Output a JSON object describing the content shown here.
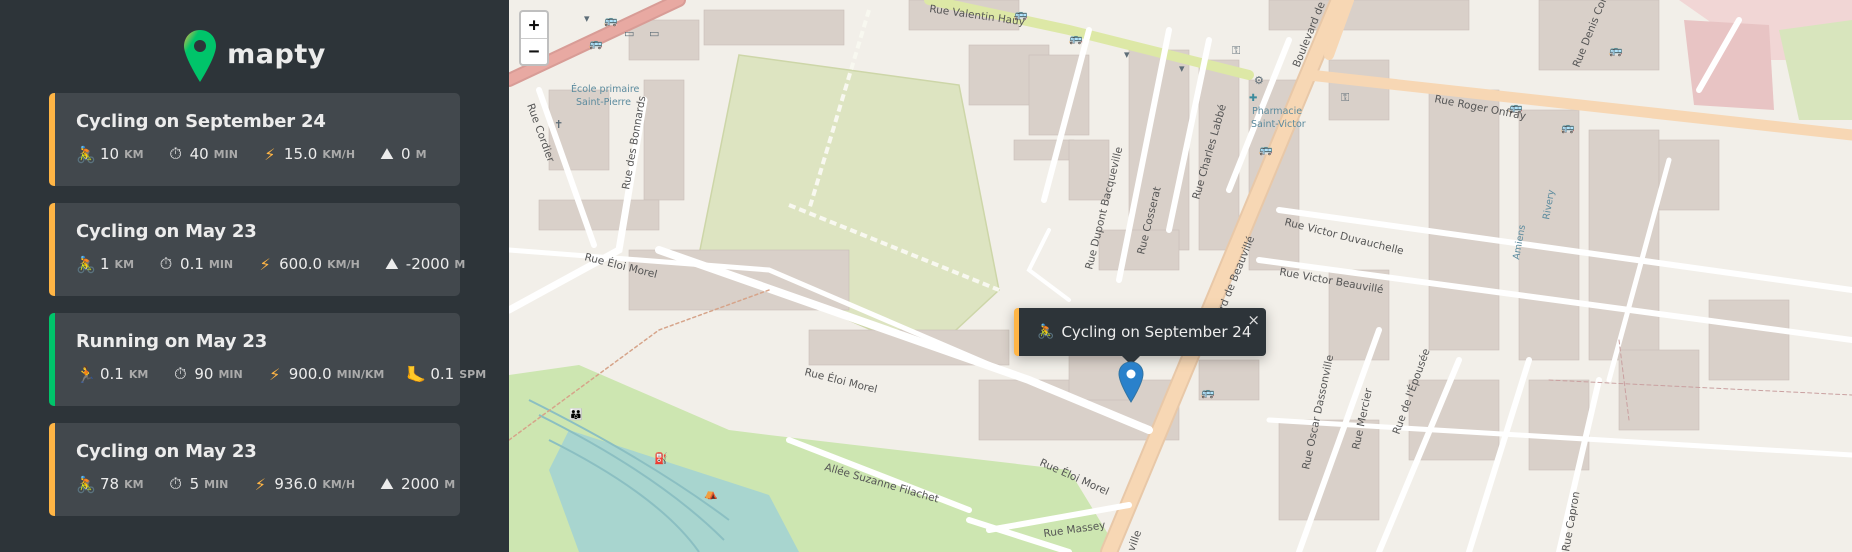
{
  "app": {
    "logo_text": "mapty",
    "accent_cycling": "#ffb545",
    "accent_running": "#00c46a"
  },
  "workouts": [
    {
      "type": "cycling",
      "title": "Cycling on September 24",
      "distance": "10",
      "distance_unit": "km",
      "duration": "40",
      "duration_unit": "min",
      "speed": "15.0",
      "speed_unit": "km/h",
      "extra": "0",
      "extra_unit": "m",
      "type_icon": "bicycle-icon",
      "extra_icon": "mountain-icon"
    },
    {
      "type": "cycling",
      "title": "Cycling on May 23",
      "distance": "1",
      "distance_unit": "km",
      "duration": "0.1",
      "duration_unit": "min",
      "speed": "600.0",
      "speed_unit": "km/h",
      "extra": "-2000",
      "extra_unit": "m",
      "type_icon": "bicycle-icon",
      "extra_icon": "mountain-icon"
    },
    {
      "type": "running",
      "title": "Running on May 23",
      "distance": "0.1",
      "distance_unit": "km",
      "duration": "90",
      "duration_unit": "min",
      "speed": "900.0",
      "speed_unit": "min/km",
      "extra": "0.1",
      "extra_unit": "spm",
      "type_icon": "runner-icon",
      "extra_icon": "foot-icon"
    },
    {
      "type": "cycling",
      "title": "Cycling on May 23",
      "distance": "78",
      "distance_unit": "km",
      "duration": "5",
      "duration_unit": "min",
      "speed": "936.0",
      "speed_unit": "km/h",
      "extra": "2000",
      "extra_unit": "m",
      "type_icon": "bicycle-icon",
      "extra_icon": "mountain-icon"
    }
  ],
  "map": {
    "zoom_in": "+",
    "zoom_out": "−",
    "popup": {
      "title": "Cycling on September 24",
      "close": "×",
      "icon": "bicycle-icon"
    },
    "labels": {
      "rue_valentin_hauy": "Rue Valentin Haüy",
      "bd_beauville_top": "Boulevard de Be",
      "rue_denis": "Rue Denis Cordo",
      "rue_roger_onfray": "Rue Roger Onfray",
      "rue_cordier": "Rue Cordier",
      "rue_bonnards": "Rue des Bonnards",
      "ecole_1": "École primaire",
      "ecole_2": "Saint-Pierre",
      "pharmacie_1": "Pharmacie",
      "pharmacie_2": "Saint-Victor",
      "rue_dupont": "Rue Dupont Bacqueville",
      "rue_cosserat": "Rue Cosserat",
      "rue_labbe": "Rue Charles Labbé",
      "rue_victor_duvauchelle": "Rue Victor Duvauchelle",
      "rue_victor_beauville": "Rue Victor Beauvillé",
      "bd_beauville": "Boulevard de Beauvillé",
      "rue_eloi_morel_1": "Rue Éloi Morel",
      "rue_eloi_morel_2": "Rue Éloi Morel",
      "rue_eloi_morel_3": "Rue Éloi Morel",
      "allee_suzanne": "Allée Suzanne Filachet",
      "rue_massey": "Rue Massey",
      "rue_oscar": "Rue Oscar Dassonville",
      "rue_mercier": "Rue Mercier",
      "rue_epousee": "Rue de l'Épousée",
      "rivery": "Rivery",
      "amiens": "Amiens",
      "rue_capron": "Rue Capron",
      "ville": "ville"
    }
  }
}
